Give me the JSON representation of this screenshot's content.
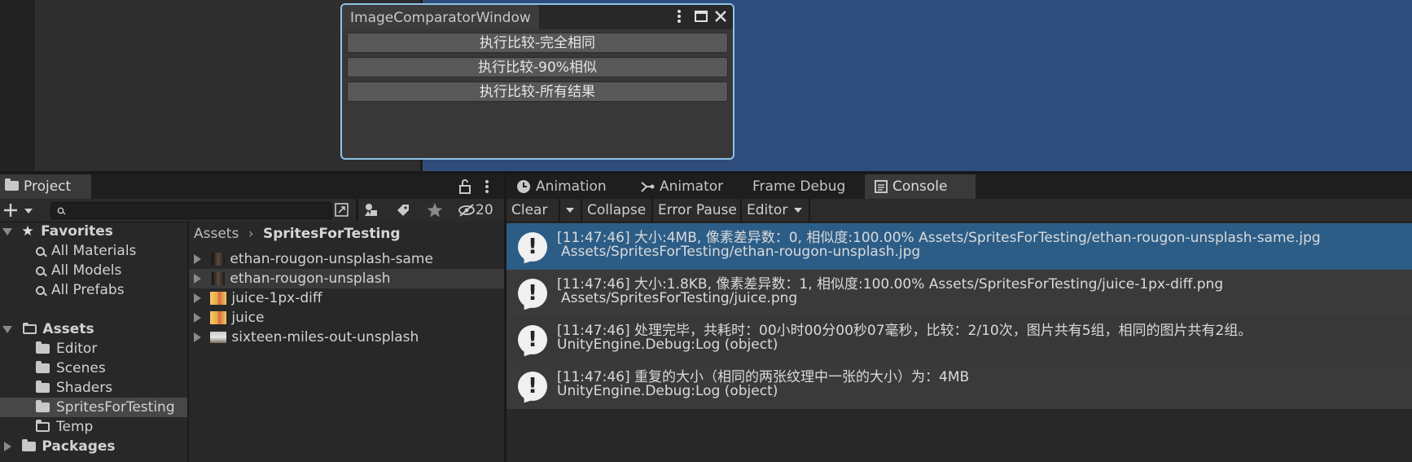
{
  "floating_window": {
    "title": "ImageComparatorWindow",
    "menu_icon": "kebab-menu-icon",
    "maximize_icon": "maximize-icon",
    "close_icon": "close-icon",
    "buttons": [
      "执行比较-完全相同",
      "执行比较-90%相似",
      "执行比较-所有结果"
    ]
  },
  "project": {
    "tab_label": "Project",
    "search_placeholder": "",
    "hidden_count": "20",
    "favorites": {
      "label": "Favorites",
      "items": [
        "All Materials",
        "All Models",
        "All Prefabs"
      ]
    },
    "assets": {
      "label": "Assets",
      "items": [
        "Editor",
        "Scenes",
        "Shaders",
        "SpritesForTesting",
        "Temp"
      ]
    },
    "packages_label": "Packages",
    "breadcrumb": {
      "root": "Assets",
      "current": "SpritesForTesting"
    },
    "files": [
      "ethan-rougon-unsplash-same",
      "ethan-rougon-unsplash",
      "juice-1px-diff",
      "juice",
      "sixteen-miles-out-unsplash"
    ]
  },
  "console": {
    "tabs": [
      "Animation",
      "Animator",
      "Frame Debug",
      "Console"
    ],
    "toolbar": {
      "clear": "Clear",
      "collapse": "Collapse",
      "error_pause": "Error Pause",
      "editor": "Editor"
    },
    "logs": [
      {
        "line1": "[11:47:46] 大小:4MB, 像素差异数：0, 相似度:100.00% Assets/SpritesForTesting/ethan-rougon-unsplash-same.jpg",
        "line2": "Assets/SpritesForTesting/ethan-rougon-unsplash.jpg"
      },
      {
        "line1": "[11:47:46] 大小:1.8KB, 像素差异数：1, 相似度:100.00% Assets/SpritesForTesting/juice-1px-diff.png",
        "line2": "Assets/SpritesForTesting/juice.png"
      },
      {
        "line1": "[11:47:46] 处理完毕，共耗时：00小时00分00秒07毫秒，比较：2/10次，图片共有5组，相同的图片共有2组。",
        "line2": "UnityEngine.Debug:Log (object)"
      },
      {
        "line1": "[11:47:46] 重复的大小（相同的两张纹理中一张的大小）为：4MB",
        "line2": "UnityEngine.Debug:Log (object)"
      }
    ]
  },
  "colors": {
    "scene_blue": "#2f4d7c",
    "selected_log": "#2c5d87",
    "window_border": "#8fc3e6"
  }
}
